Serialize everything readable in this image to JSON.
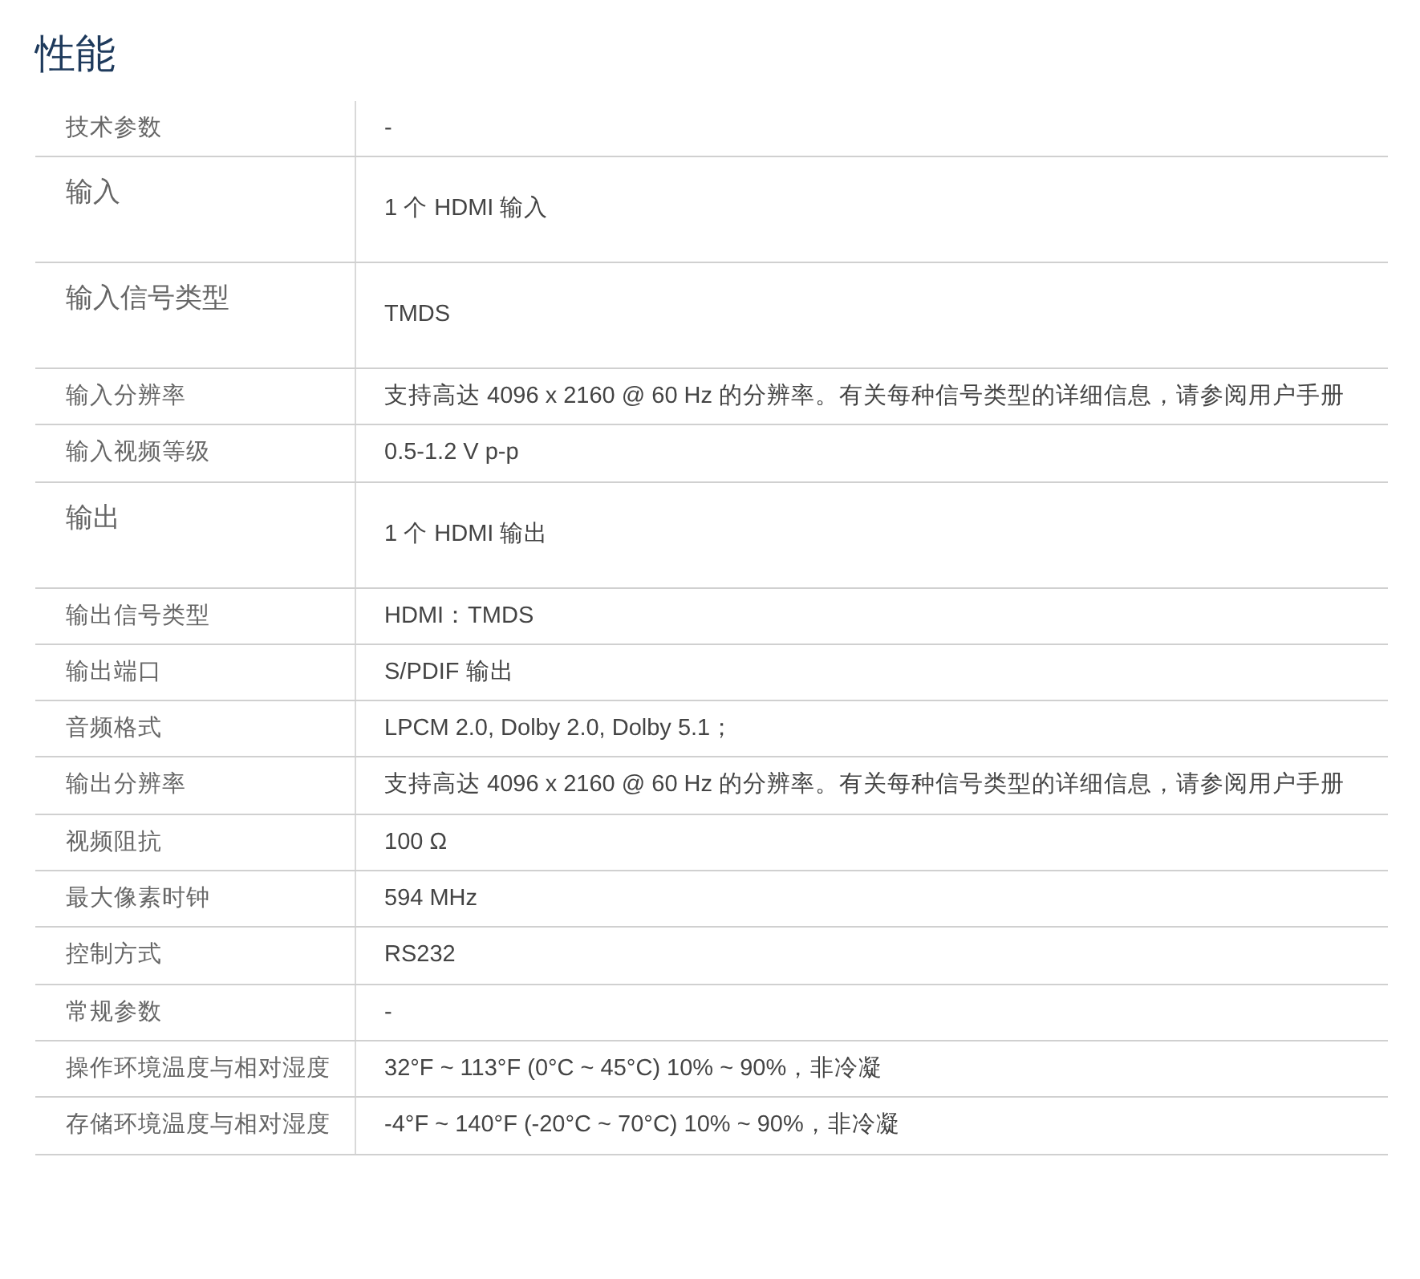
{
  "title": "性能",
  "rows": [
    {
      "kind": "normal",
      "label": "技术参数",
      "value": "-"
    },
    {
      "kind": "tall",
      "label": "输入",
      "value": "1 个 HDMI 输入"
    },
    {
      "kind": "tall",
      "label": "输入信号类型",
      "value": "TMDS"
    },
    {
      "kind": "normal",
      "label": "输入分辨率",
      "value": "支持高达 4096 x 2160 @ 60 Hz 的分辨率。有关每种信号类型的详细信息，请参阅用户手册"
    },
    {
      "kind": "normal",
      "label": "输入视频等级",
      "value": "0.5-1.2 V p-p"
    },
    {
      "kind": "tall",
      "label": "输出",
      "value": "1 个 HDMI 输出"
    },
    {
      "kind": "normal",
      "label": "输出信号类型",
      "value": "HDMI：TMDS"
    },
    {
      "kind": "normal",
      "label": "输出端口",
      "value": "S/PDIF 输出"
    },
    {
      "kind": "normal",
      "label": "音频格式",
      "value": "LPCM 2.0, Dolby 2.0, Dolby 5.1；"
    },
    {
      "kind": "normal",
      "label": "输出分辨率",
      "value": "支持高达 4096 x 2160 @ 60 Hz 的分辨率。有关每种信号类型的详细信息，请参阅用户手册"
    },
    {
      "kind": "normal",
      "label": "视频阻抗",
      "value": "100 Ω"
    },
    {
      "kind": "normal",
      "label": "最大像素时钟",
      "value": "594 MHz"
    },
    {
      "kind": "normal",
      "label": "控制方式",
      "value": "RS232"
    },
    {
      "kind": "normal",
      "label": "常规参数",
      "value": "-"
    },
    {
      "kind": "normal",
      "label": "操作环境温度与相对湿度",
      "value": "32°F ~ 113°F (0°C ~ 45°C) 10% ~ 90%，非冷凝"
    },
    {
      "kind": "normal",
      "label": "存储环境温度与相对湿度",
      "value": "-4°F ~ 140°F (-20°C ~ 70°C) 10% ~ 90%，非冷凝"
    }
  ]
}
